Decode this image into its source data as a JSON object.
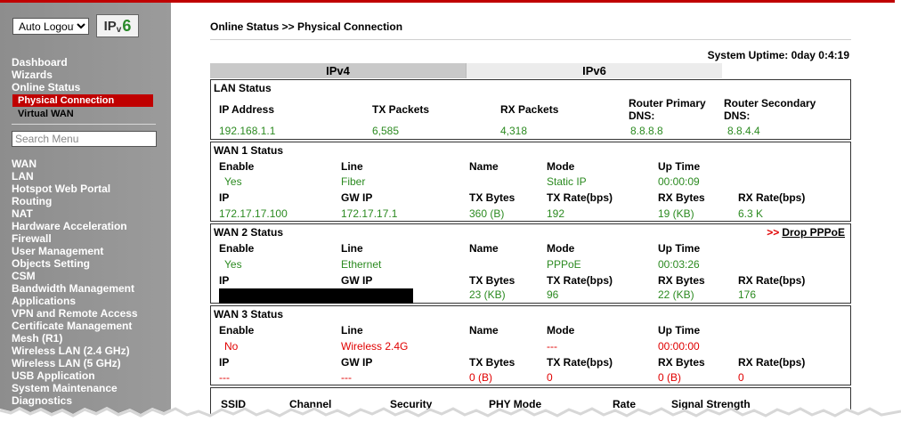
{
  "sidebar": {
    "logout_option": "Auto Logout",
    "ipv6_badge": {
      "prefix": "IP",
      "v": "v",
      "six": "6"
    },
    "top_menu": [
      "Dashboard",
      "Wizards",
      "Online Status"
    ],
    "submenu_active": "Physical Connection",
    "submenu_other": "Virtual WAN",
    "search_placeholder": "Search Menu",
    "main_menu": [
      "WAN",
      "LAN",
      "Hotspot Web Portal",
      "Routing",
      "NAT",
      "Hardware Acceleration",
      "Firewall",
      "User Management",
      "Objects Setting",
      "CSM",
      "Bandwidth Management",
      "Applications",
      "VPN and Remote Access",
      "Certificate Management",
      "Mesh (R1)",
      "Wireless LAN (2.4 GHz)",
      "Wireless LAN (5 GHz)",
      "USB Application",
      "System Maintenance",
      "Diagnostics"
    ]
  },
  "header": {
    "breadcrumb": "Online Status >> Physical Connection",
    "uptime": "System Uptime: 0day 0:4:19"
  },
  "tabs": [
    "IPv4",
    "IPv6"
  ],
  "lan": {
    "title": "LAN Status",
    "headers": {
      "ip": "IP Address",
      "tx": "TX Packets",
      "rx": "RX Packets",
      "dns1a": "Router Primary",
      "dns1b": "DNS:",
      "dns2a": "Router Secondary",
      "dns2b": "DNS:"
    },
    "values": {
      "ip": "192.168.1.1",
      "tx": "6,585",
      "rx": "4,318",
      "dns1": "8.8.8.8",
      "dns2": "8.8.4.4"
    }
  },
  "labels": {
    "enable": "Enable",
    "line": "Line",
    "name": "Name",
    "mode": "Mode",
    "uptime": "Up Time",
    "ip": "IP",
    "gwip": "GW IP",
    "txbytes": "TX Bytes",
    "txrate": "TX Rate(bps)",
    "rxbytes": "RX Bytes",
    "rxrate": "RX Rate(bps)"
  },
  "wan1": {
    "title": "WAN 1 Status",
    "enable": "Yes",
    "line": "Fiber",
    "mode": "Static IP",
    "uptime": "00:00:09",
    "ip": "172.17.17.100",
    "gwip": "172.17.17.1",
    "txbytes": "360 (B)",
    "txrate": "192",
    "rxbytes": "19 (KB)",
    "rxrate": "6.3 K"
  },
  "wan2": {
    "title": "WAN 2 Status",
    "drop_arrow": ">>",
    "drop_label": "Drop PPPoE",
    "enable": "Yes",
    "line": "Ethernet",
    "mode": "PPPoE",
    "uptime": "00:03:26",
    "txbytes": "23 (KB)",
    "txrate": "96",
    "rxbytes": "22 (KB)",
    "rxrate": "176"
  },
  "wan3": {
    "title": "WAN 3 Status",
    "enable": "No",
    "line": "Wireless 2.4G",
    "mode": "---",
    "uptime": "00:00:00",
    "ip": "---",
    "gwip": "---",
    "txbytes": "0 (B)",
    "txrate": "0",
    "rxbytes": "0 (B)",
    "rxrate": "0"
  },
  "wlan": {
    "headers": [
      "SSID",
      "Channel",
      "Security",
      "PHY Mode",
      "Rate",
      "Signal Strength"
    ]
  },
  "colors": {
    "accent": "#c00000",
    "value_green": "#2b8a20",
    "value_red": "#e00000",
    "sidebar": "#959595"
  }
}
